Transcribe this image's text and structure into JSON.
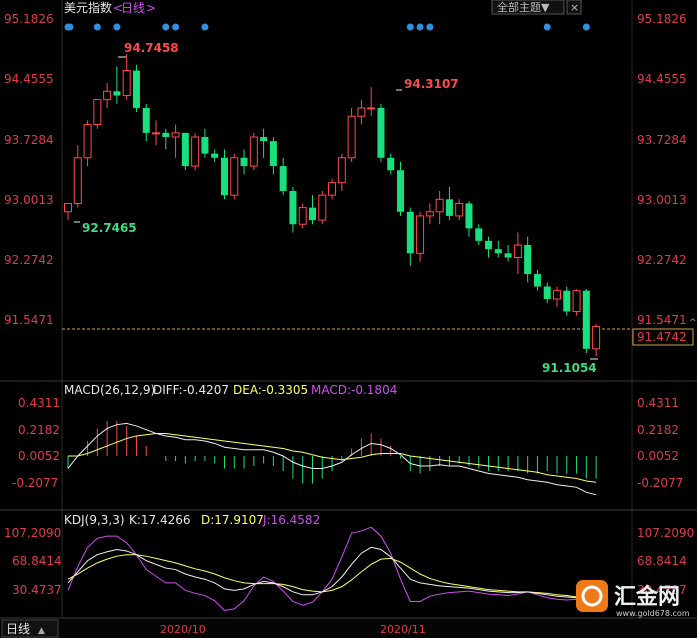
{
  "header": {
    "title": "美元指数",
    "period": "日线",
    "theme_button": "全部主题▼",
    "close_label": "×"
  },
  "price_axis": {
    "left_ticks": [
      "95.1826",
      "94.4555",
      "93.7284",
      "93.0013",
      "92.2742",
      "91.5471"
    ],
    "right_ticks": [
      "95.1826",
      "94.4555",
      "93.7284",
      "93.0013",
      "92.2742",
      "91.5471"
    ],
    "current_price": "91.4742"
  },
  "annotations": {
    "high_label": "94.7458",
    "mid_high_label": "94.3107",
    "low_left_label": "92.7465",
    "low_right_label": "91.1054"
  },
  "macd": {
    "title": "MACD(26,12,9)",
    "diff_text": "DIFF:-0.4207",
    "dea_text": "DEA:-0.3305",
    "macd_text": "MACD:-0.1804",
    "ticks": [
      "0.4311",
      "0.2182",
      "0.0052",
      "-0.2077"
    ]
  },
  "kdj": {
    "title": "KDJ(9,3,3)",
    "k_text": "K:17.4266",
    "d_text": "D:17.9107",
    "j_text": "J:16.4582",
    "ticks": [
      "107.2090",
      "68.8414",
      "30.4737"
    ]
  },
  "time_axis": {
    "period_label": "日线",
    "arrow_label": "▲",
    "labels": [
      "2020/10",
      "2020/11"
    ]
  },
  "watermark": {
    "brand": "汇金网",
    "url": "www.gold678.com"
  },
  "colors": {
    "up": "#ff4a4a",
    "down": "#19e07e",
    "axis_text": "#e0394b",
    "dea_line": "#ffff66",
    "macd_label": "#d04cf0",
    "dashed": "#d4a54a"
  },
  "chart_data": [
    {
      "type": "candlestick",
      "title": "美元指数 日线",
      "ylim": [
        91.1054,
        95.1826
      ],
      "y_ticks": [
        95.1826,
        94.4555,
        93.7284,
        93.0013,
        92.2742,
        91.5471
      ],
      "x_labels": [
        "2020/10",
        "2020/11"
      ],
      "current_price": 91.4742,
      "event_markers_count": 12,
      "candles": [
        {
          "o": 92.85,
          "h": 92.95,
          "l": 92.75,
          "c": 92.95
        },
        {
          "o": 92.95,
          "h": 93.65,
          "l": 92.9,
          "c": 93.5
        },
        {
          "o": 93.5,
          "h": 93.95,
          "l": 93.4,
          "c": 93.9
        },
        {
          "o": 93.9,
          "h": 94.2,
          "l": 93.85,
          "c": 94.2
        },
        {
          "o": 94.2,
          "h": 94.4,
          "l": 94.1,
          "c": 94.3
        },
        {
          "o": 94.3,
          "h": 94.6,
          "l": 94.15,
          "c": 94.25
        },
        {
          "o": 94.25,
          "h": 94.75,
          "l": 94.2,
          "c": 94.55
        },
        {
          "o": 94.55,
          "h": 94.62,
          "l": 94.05,
          "c": 94.1
        },
        {
          "o": 94.1,
          "h": 94.15,
          "l": 93.7,
          "c": 93.8
        },
        {
          "o": 93.8,
          "h": 93.95,
          "l": 93.65,
          "c": 93.8
        },
        {
          "o": 93.8,
          "h": 93.85,
          "l": 93.6,
          "c": 93.75
        },
        {
          "o": 93.75,
          "h": 93.9,
          "l": 93.5,
          "c": 93.8
        },
        {
          "o": 93.8,
          "h": 93.8,
          "l": 93.35,
          "c": 93.4
        },
        {
          "o": 93.4,
          "h": 93.8,
          "l": 93.35,
          "c": 93.75
        },
        {
          "o": 93.75,
          "h": 93.85,
          "l": 93.5,
          "c": 93.55
        },
        {
          "o": 93.55,
          "h": 93.6,
          "l": 93.45,
          "c": 93.5
        },
        {
          "o": 93.5,
          "h": 93.6,
          "l": 93.0,
          "c": 93.05
        },
        {
          "o": 93.05,
          "h": 93.55,
          "l": 93.0,
          "c": 93.5
        },
        {
          "o": 93.5,
          "h": 93.6,
          "l": 93.3,
          "c": 93.4
        },
        {
          "o": 93.4,
          "h": 93.8,
          "l": 93.35,
          "c": 93.75
        },
        {
          "o": 93.75,
          "h": 93.85,
          "l": 93.5,
          "c": 93.7
        },
        {
          "o": 93.7,
          "h": 93.75,
          "l": 93.3,
          "c": 93.4
        },
        {
          "o": 93.4,
          "h": 93.5,
          "l": 93.05,
          "c": 93.1
        },
        {
          "o": 93.1,
          "h": 93.15,
          "l": 92.6,
          "c": 92.7
        },
        {
          "o": 92.7,
          "h": 92.95,
          "l": 92.65,
          "c": 92.9
        },
        {
          "o": 92.9,
          "h": 93.05,
          "l": 92.7,
          "c": 92.75
        },
        {
          "o": 92.75,
          "h": 93.1,
          "l": 92.7,
          "c": 93.05
        },
        {
          "o": 93.05,
          "h": 93.25,
          "l": 93.0,
          "c": 93.2
        },
        {
          "o": 93.2,
          "h": 93.55,
          "l": 93.1,
          "c": 93.5
        },
        {
          "o": 93.5,
          "h": 94.1,
          "l": 93.45,
          "c": 94.0
        },
        {
          "o": 94.0,
          "h": 94.2,
          "l": 93.9,
          "c": 94.1
        },
        {
          "o": 94.1,
          "h": 94.35,
          "l": 94.0,
          "c": 94.1
        },
        {
          "o": 94.1,
          "h": 94.15,
          "l": 93.45,
          "c": 93.5
        },
        {
          "o": 93.5,
          "h": 93.55,
          "l": 93.3,
          "c": 93.35
        },
        {
          "o": 93.35,
          "h": 93.45,
          "l": 92.8,
          "c": 92.85
        },
        {
          "o": 92.85,
          "h": 92.9,
          "l": 92.2,
          "c": 92.35
        },
        {
          "o": 92.35,
          "h": 92.85,
          "l": 92.25,
          "c": 92.8
        },
        {
          "o": 92.8,
          "h": 92.95,
          "l": 92.7,
          "c": 92.85
        },
        {
          "o": 92.85,
          "h": 93.1,
          "l": 92.7,
          "c": 93.0
        },
        {
          "o": 93.0,
          "h": 93.15,
          "l": 92.75,
          "c": 92.8
        },
        {
          "o": 92.8,
          "h": 93.0,
          "l": 92.75,
          "c": 92.95
        },
        {
          "o": 92.95,
          "h": 92.98,
          "l": 92.55,
          "c": 92.65
        },
        {
          "o": 92.65,
          "h": 92.7,
          "l": 92.45,
          "c": 92.5
        },
        {
          "o": 92.5,
          "h": 92.55,
          "l": 92.3,
          "c": 92.4
        },
        {
          "o": 92.4,
          "h": 92.5,
          "l": 92.3,
          "c": 92.35
        },
        {
          "o": 92.35,
          "h": 92.45,
          "l": 92.25,
          "c": 92.3
        },
        {
          "o": 92.3,
          "h": 92.6,
          "l": 92.1,
          "c": 92.45
        },
        {
          "o": 92.45,
          "h": 92.55,
          "l": 92.0,
          "c": 92.1
        },
        {
          "o": 92.1,
          "h": 92.15,
          "l": 91.9,
          "c": 91.95
        },
        {
          "o": 91.95,
          "h": 92.0,
          "l": 91.75,
          "c": 91.8
        },
        {
          "o": 91.8,
          "h": 91.95,
          "l": 91.7,
          "c": 91.9
        },
        {
          "o": 91.9,
          "h": 91.95,
          "l": 91.6,
          "c": 91.65
        },
        {
          "o": 91.65,
          "h": 91.92,
          "l": 91.6,
          "c": 91.9
        },
        {
          "o": 91.9,
          "h": 91.92,
          "l": 91.15,
          "c": 91.2
        },
        {
          "o": 91.2,
          "h": 91.5,
          "l": 91.11,
          "c": 91.47
        }
      ]
    },
    {
      "type": "macd",
      "title": "MACD(26,12,9)",
      "ylim": [
        -0.36,
        0.53
      ],
      "y_ticks": [
        0.4311,
        0.2182,
        0.0052,
        -0.2077
      ],
      "DIFF": -0.4207,
      "DEA": -0.3305,
      "MACD": -0.1804,
      "diff_series": [
        -0.1,
        0.0,
        0.08,
        0.16,
        0.22,
        0.25,
        0.26,
        0.24,
        0.21,
        0.18,
        0.16,
        0.15,
        0.13,
        0.13,
        0.12,
        0.1,
        0.07,
        0.06,
        0.05,
        0.05,
        0.05,
        0.03,
        0.0,
        -0.05,
        -0.08,
        -0.1,
        -0.1,
        -0.08,
        -0.05,
        0.01,
        0.06,
        0.1,
        0.09,
        0.06,
        0.01,
        -0.06,
        -0.08,
        -0.08,
        -0.07,
        -0.08,
        -0.08,
        -0.1,
        -0.12,
        -0.14,
        -0.15,
        -0.16,
        -0.17,
        -0.19,
        -0.2,
        -0.21,
        -0.23,
        -0.24,
        -0.25,
        -0.29,
        -0.31
      ],
      "dea_series": [
        0.0,
        0.0,
        0.02,
        0.05,
        0.08,
        0.11,
        0.14,
        0.16,
        0.17,
        0.18,
        0.18,
        0.17,
        0.16,
        0.15,
        0.14,
        0.13,
        0.12,
        0.11,
        0.1,
        0.09,
        0.08,
        0.07,
        0.06,
        0.04,
        0.03,
        0.01,
        -0.01,
        -0.02,
        -0.03,
        -0.02,
        -0.01,
        0.01,
        0.02,
        0.02,
        0.02,
        0.0,
        -0.01,
        -0.02,
        -0.03,
        -0.04,
        -0.05,
        -0.06,
        -0.07,
        -0.08,
        -0.09,
        -0.1,
        -0.11,
        -0.12,
        -0.13,
        -0.15,
        -0.16,
        -0.17,
        -0.18,
        -0.2,
        -0.21
      ],
      "macd_series": [
        -0.1,
        0.0,
        0.12,
        0.22,
        0.28,
        0.28,
        0.24,
        0.16,
        0.08,
        0.0,
        -0.04,
        -0.04,
        -0.06,
        -0.04,
        -0.04,
        -0.06,
        -0.1,
        -0.1,
        -0.1,
        -0.08,
        -0.06,
        -0.08,
        -0.12,
        -0.18,
        -0.22,
        -0.22,
        -0.18,
        -0.12,
        -0.04,
        0.06,
        0.14,
        0.18,
        0.14,
        0.08,
        -0.02,
        -0.12,
        -0.14,
        -0.12,
        -0.08,
        -0.08,
        -0.06,
        -0.08,
        -0.1,
        -0.12,
        -0.12,
        -0.12,
        -0.12,
        -0.14,
        -0.14,
        -0.12,
        -0.14,
        -0.14,
        -0.14,
        -0.18,
        -0.18
      ]
    },
    {
      "type": "kdj",
      "title": "KDJ(9,3,3)",
      "ylim": [
        0,
        115
      ],
      "y_ticks": [
        107.209,
        68.8414,
        30.4737
      ],
      "K": 17.4266,
      "D": 17.9107,
      "J": 16.4582,
      "k_series": [
        40,
        55,
        70,
        78,
        82,
        85,
        83,
        78,
        70,
        65,
        60,
        58,
        52,
        48,
        45,
        40,
        32,
        30,
        32,
        38,
        42,
        40,
        35,
        28,
        24,
        24,
        28,
        35,
        48,
        65,
        80,
        88,
        85,
        75,
        60,
        45,
        40,
        38,
        36,
        35,
        34,
        33,
        31,
        29,
        28,
        27,
        27,
        28,
        26,
        24,
        22,
        21,
        20,
        19,
        17
      ],
      "d_series": [
        45,
        52,
        60,
        67,
        72,
        76,
        78,
        78,
        76,
        73,
        70,
        67,
        63,
        59,
        56,
        52,
        47,
        43,
        40,
        39,
        39,
        39,
        38,
        35,
        31,
        29,
        28,
        30,
        35,
        44,
        55,
        65,
        72,
        73,
        68,
        60,
        52,
        46,
        42,
        39,
        37,
        35,
        33,
        31,
        30,
        29,
        28,
        28,
        27,
        26,
        24,
        23,
        21,
        20,
        18
      ],
      "j_series": [
        30,
        62,
        88,
        100,
        103,
        103,
        94,
        78,
        58,
        49,
        40,
        40,
        30,
        26,
        23,
        16,
        3,
        5,
        16,
        36,
        48,
        42,
        29,
        15,
        10,
        14,
        28,
        45,
        75,
        107,
        110,
        115,
        103,
        80,
        45,
        15,
        15,
        22,
        25,
        27,
        28,
        29,
        27,
        25,
        24,
        23,
        25,
        28,
        24,
        20,
        18,
        17,
        18,
        17,
        16
      ]
    }
  ]
}
